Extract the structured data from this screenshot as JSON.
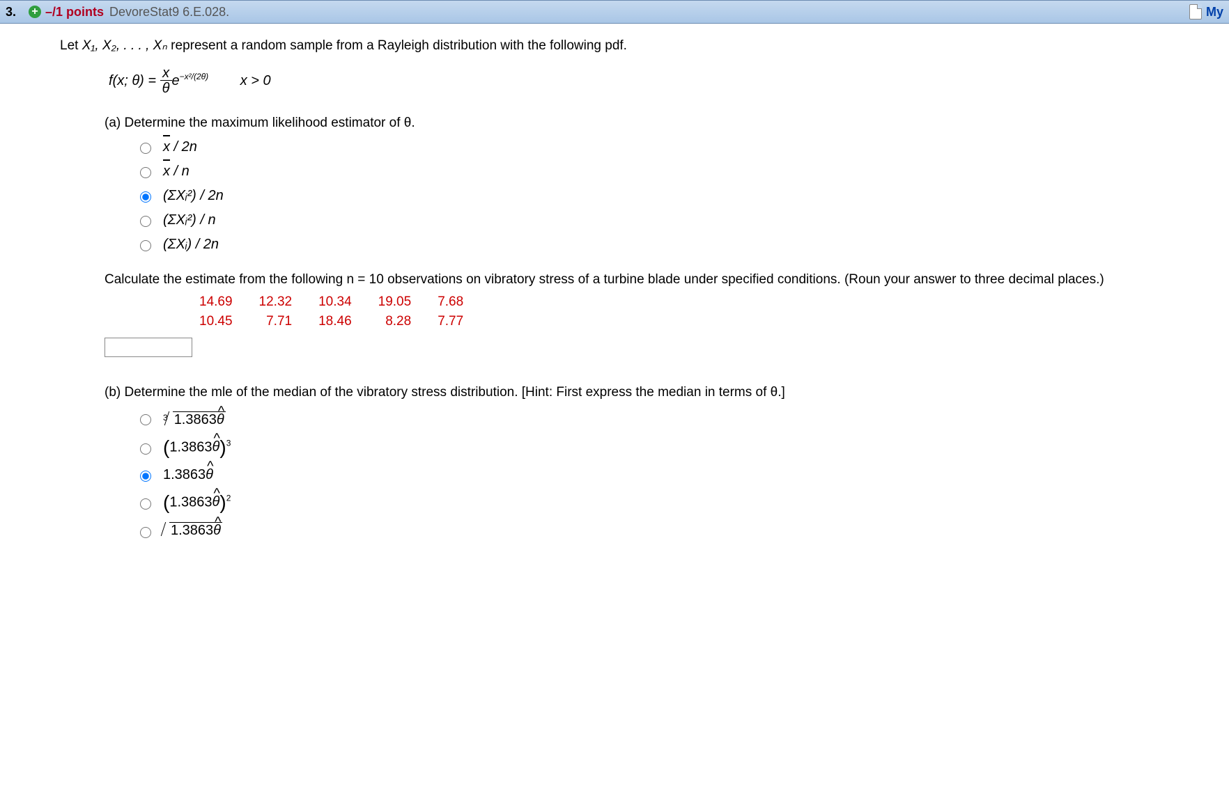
{
  "header": {
    "qnum": "3.",
    "points": "–/1 points",
    "source": "DevoreStat9 6.E.028.",
    "my": "My"
  },
  "intro_pre": "Let ",
  "intro_mid": " represent a random sample from a Rayleigh distribution with the following pdf.",
  "formula": {
    "lhs": "f(x; θ) = ",
    "num_x": "x",
    "den": "θ",
    "exp_pre": "e",
    "exp_sup": "−x²/(2θ)",
    "cond": "x > 0"
  },
  "part_a": "(a) Determine the maximum likelihood estimator of θ.",
  "opts_a": {
    "o1_suffix": " / 2n",
    "o2_suffix": " / n",
    "o3": "(ΣXᵢ²) / 2n",
    "o4": "(ΣXᵢ²) / n",
    "o5": "(ΣXᵢ) / 2n"
  },
  "calc_text": "Calculate the estimate from the following n = 10 observations on vibratory stress of a turbine blade under specified conditions. (Roun your answer to three decimal places.)",
  "data_rows": [
    [
      "14.69",
      "12.32",
      "10.34",
      "19.05",
      "7.68"
    ],
    [
      "10.45",
      "7.71",
      "18.46",
      "8.28",
      "7.77"
    ]
  ],
  "part_b": "(b) Determine the mle of the median of the vibratory stress distribution. [Hint: First express the median in terms of θ.]",
  "val": "1.3863",
  "theta": "θ",
  "xvar": "x",
  "Xvars": "X₁, X₂, . . . , Xₙ"
}
